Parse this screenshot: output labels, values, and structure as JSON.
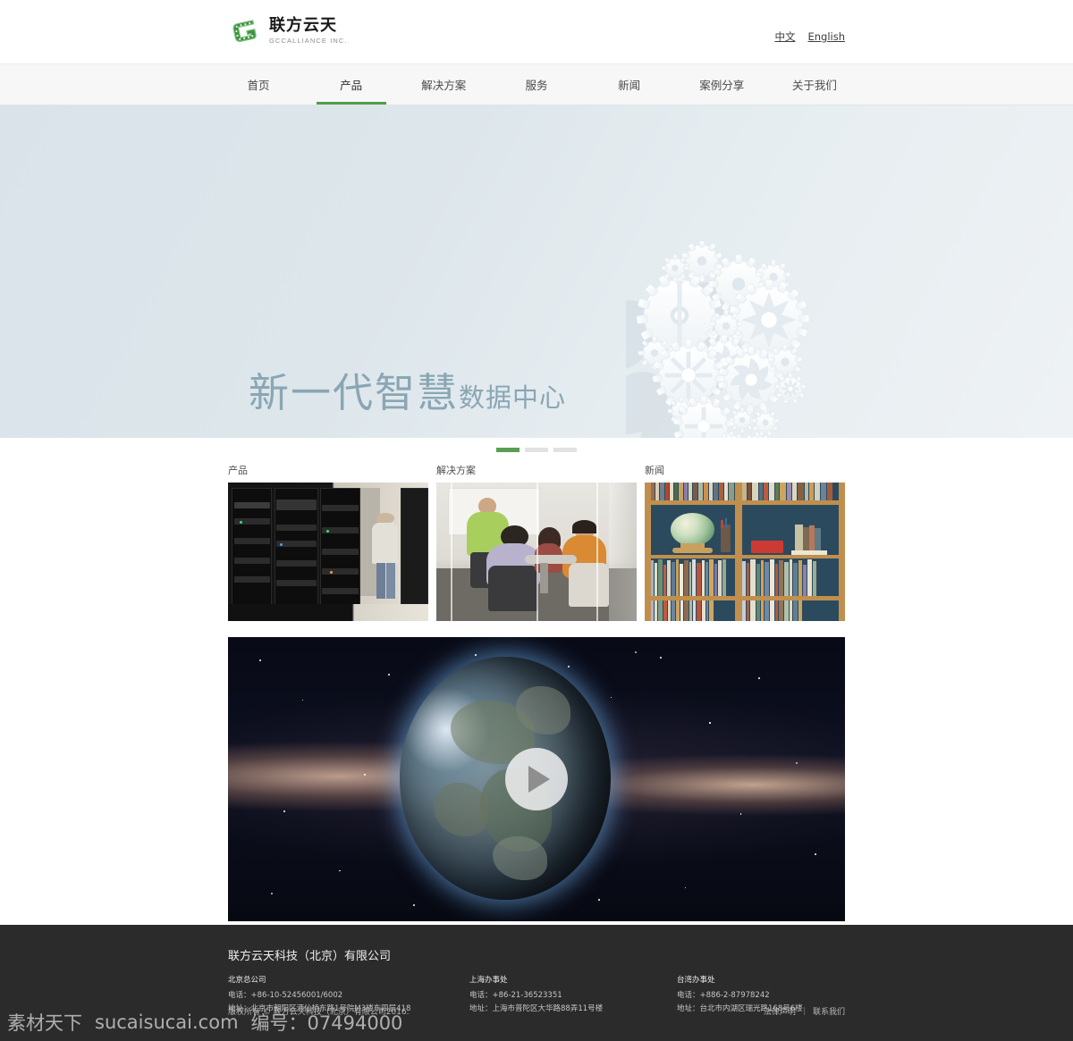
{
  "brand": {
    "logo_icon": "g-logo-icon",
    "name_cn": "联方云天",
    "name_en": "GCCALLIANCE INC.",
    "accent_color": "#4b9e4b"
  },
  "lang": {
    "chinese": "中文",
    "english": "English"
  },
  "nav": {
    "items": [
      {
        "label": "首页",
        "active": false
      },
      {
        "label": "产品",
        "active": true
      },
      {
        "label": "解决方案",
        "active": false
      },
      {
        "label": "服务",
        "active": false
      },
      {
        "label": "新闻",
        "active": false
      },
      {
        "label": "案例分享",
        "active": false
      },
      {
        "label": "关于我们",
        "active": false
      }
    ]
  },
  "hero": {
    "title_main": "新一代智慧",
    "title_sub": "数据中心",
    "graphic": "lightbulb-gears-icon",
    "background_color": "#dce5ea",
    "text_color": "#8aa6b4"
  },
  "carousel": {
    "slides": 3,
    "active_index": 0,
    "active_color": "#5a9e54",
    "inactive_color": "#e2e2e2"
  },
  "cards": [
    {
      "label": "产品",
      "image": "data-center-server-racks-photo"
    },
    {
      "label": "解决方案",
      "image": "business-meeting-room-photo"
    },
    {
      "label": "新闻",
      "image": "library-bookshelf-globe-photo"
    }
  ],
  "video": {
    "image": "earth-in-space-milky-way-photo",
    "play_icon": "play-triangle-icon"
  },
  "footer": {
    "company": "联方云天科技（北京）有限公司",
    "offices": [
      {
        "title": "北京总公司",
        "phone": "电话：+86-10-52456001/6002",
        "address": "地址：北京市朝阳区酒仙桥东路1号院M3楼东四层418"
      },
      {
        "title": "上海办事处",
        "phone": "电话：+86-21-36523351",
        "address": "地址：上海市普陀区大华路88弄11号楼"
      },
      {
        "title": "台湾办事处",
        "phone": "电话：+886-2-87978242",
        "address": "地址：台北市内湖区瑞光路168号6楼"
      }
    ],
    "copyright": "版权所有 © 联方云天科技（北京）有限公司2016.",
    "links": {
      "legal": "法律声明",
      "separator": "|",
      "contact": "联系我们"
    },
    "background_color": "#2b2b2b"
  },
  "watermark": {
    "site_cn": "素材天下",
    "site_url": "sucaisucai.com",
    "code": "编号：07494000"
  }
}
